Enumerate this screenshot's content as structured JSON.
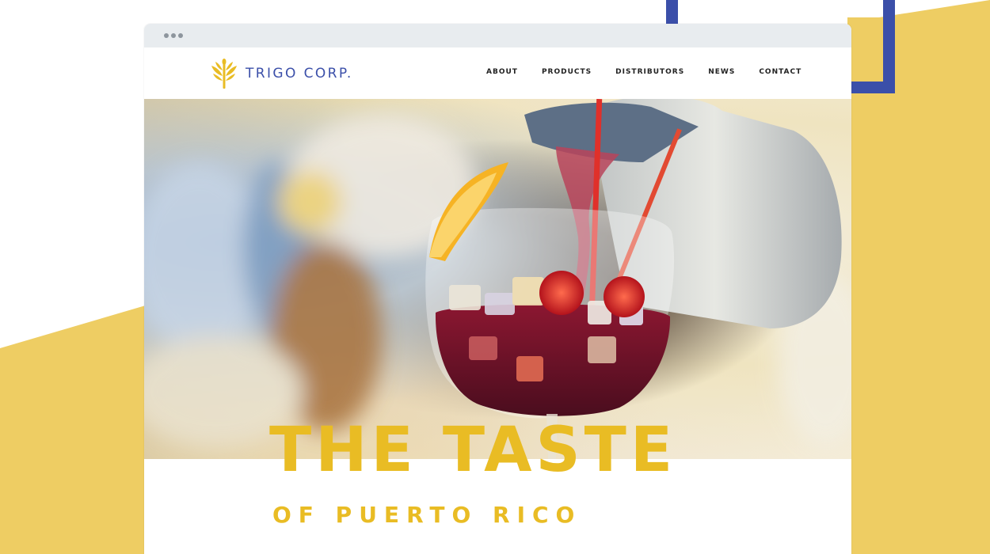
{
  "brand": {
    "name": "TRIGO CORP.",
    "icon": "wheat-icon",
    "color": "#3b4fa9"
  },
  "nav": {
    "items": [
      "ABOUT",
      "PRODUCTS",
      "DISTRIBUTORS",
      "NEWS",
      "CONTACT"
    ]
  },
  "hero": {
    "image": "sangria-pour-photo",
    "title": "THE TASTE",
    "subtitle": "OF PUERTO RICO",
    "accent_color": "#e9bc24"
  },
  "decor": {
    "yellow": "#eecd63",
    "blue": "#3b4fa9"
  }
}
